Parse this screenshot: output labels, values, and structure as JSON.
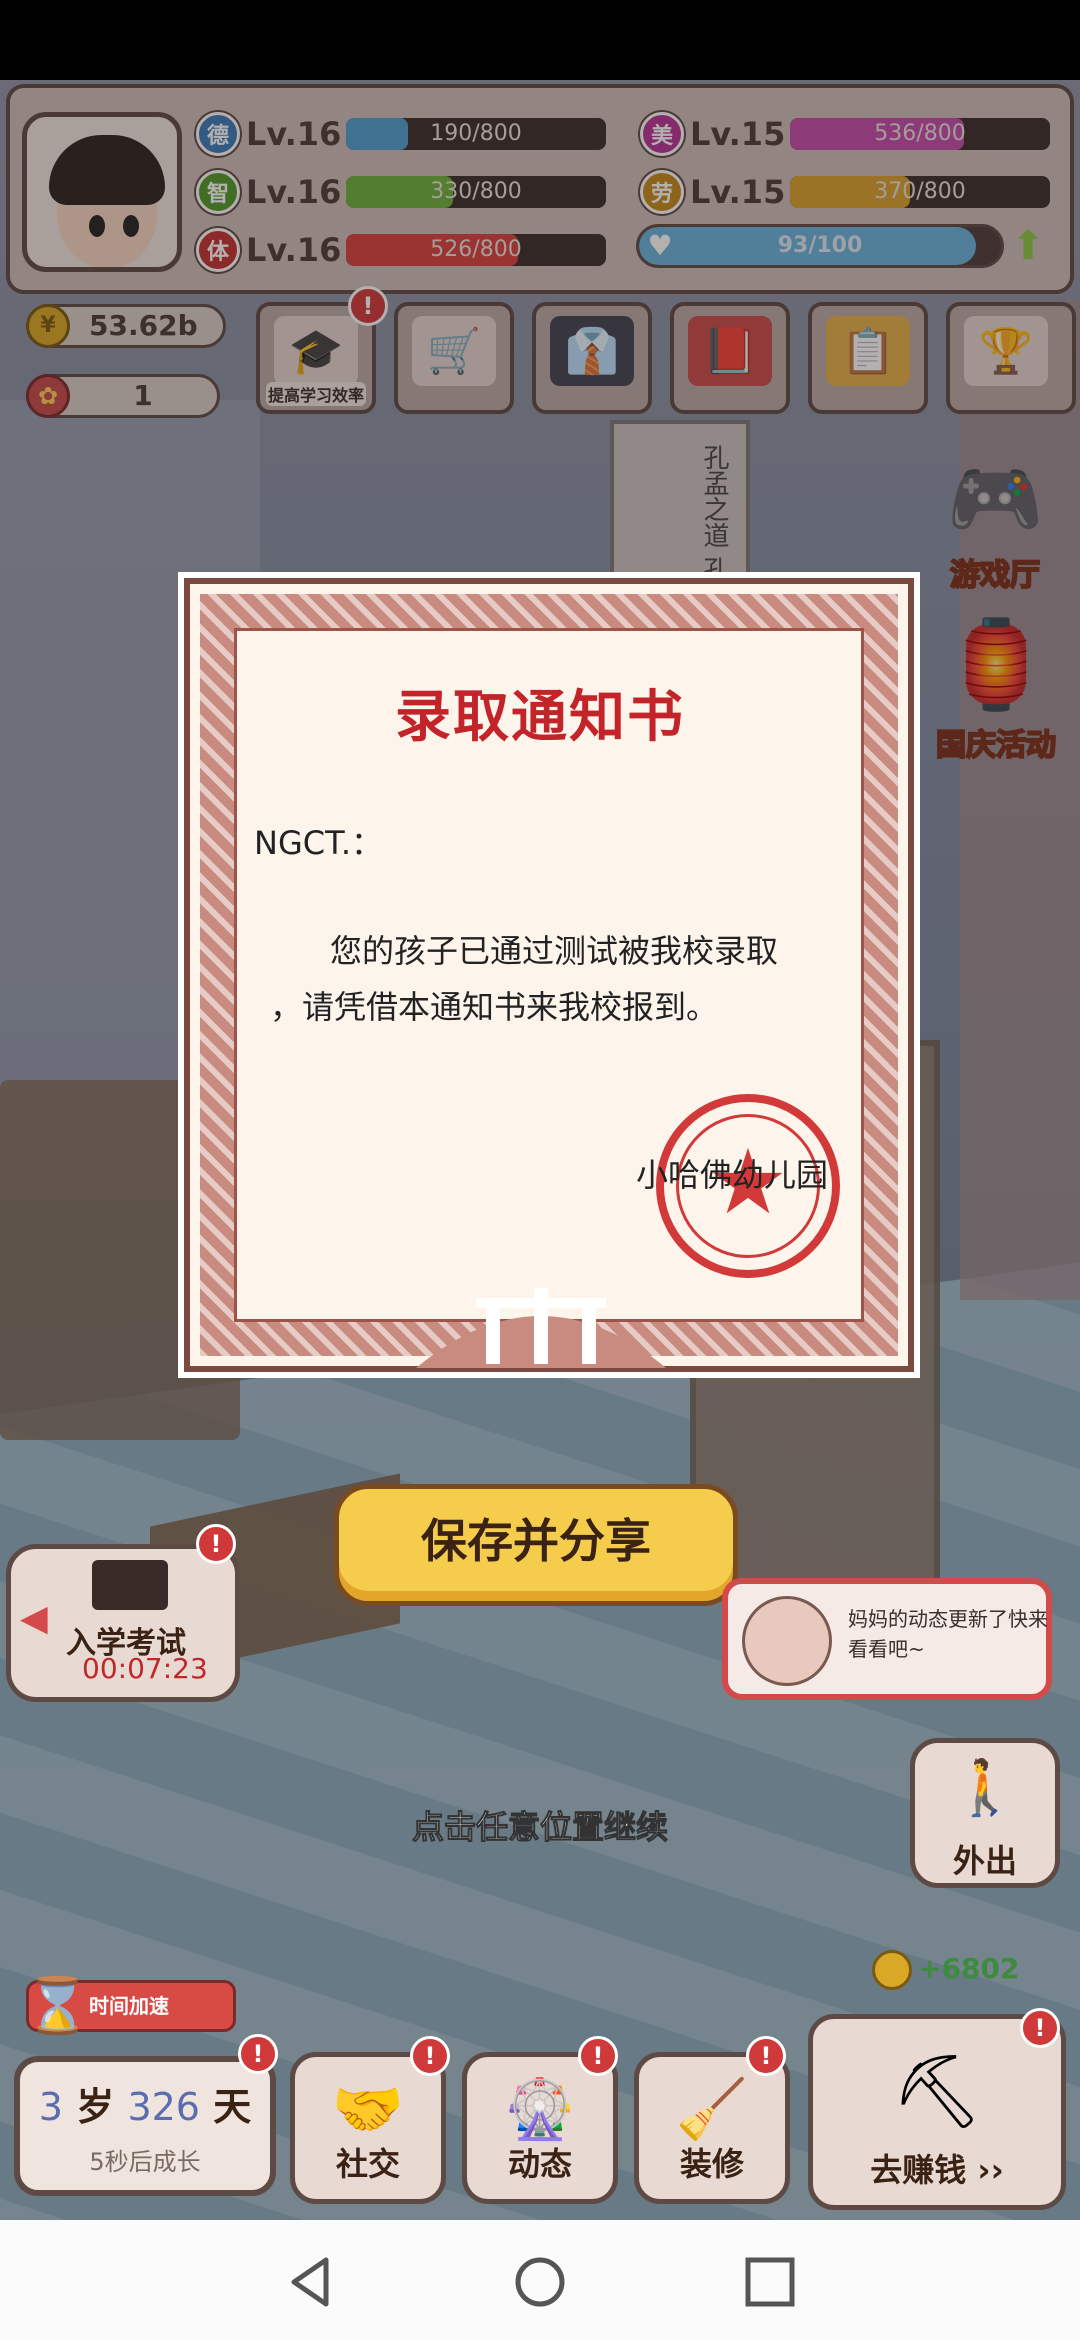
{
  "stats": [
    {
      "icon": "德",
      "level": "Lv.16",
      "bar_text": "190/800",
      "progress": 0.24,
      "color": "#4f9fcf",
      "icon_color": "#3a7bb8"
    },
    {
      "icon": "智",
      "level": "Lv.16",
      "bar_text": "330/800",
      "progress": 0.41,
      "color": "#6bb33a",
      "icon_color": "#4e9a2a"
    },
    {
      "icon": "体",
      "level": "Lv.16",
      "bar_text": "526/800",
      "progress": 0.66,
      "color": "#d8413f",
      "icon_color": "#c23030"
    },
    {
      "icon": "美",
      "level": "Lv.15",
      "bar_text": "536/800",
      "progress": 0.67,
      "color": "#c44aa9",
      "icon_color": "#b43396"
    },
    {
      "icon": "劳",
      "level": "Lv.15",
      "bar_text": "370/800",
      "progress": 0.46,
      "color": "#d7a12c",
      "icon_color": "#c28a1a"
    }
  ],
  "mood": {
    "bar_text": "93/100",
    "progress": 0.93
  },
  "currency": {
    "coins": "53.62b",
    "flowers": "1",
    "coin_icon": "coin-icon",
    "flower_icon": "flower-icon"
  },
  "toolbar": {
    "study_label": "提高学习效率",
    "items": [
      "study-efficiency",
      "shop-cart",
      "suit",
      "book",
      "clipboard",
      "ranking-podium"
    ]
  },
  "side": {
    "game_hall": "游戏厅",
    "national_day": "国庆活动"
  },
  "poster_text": "孔孟之道 孔之正宗 赶紧来学",
  "certificate": {
    "title": "录取通知书",
    "addressee": "NGCT.：",
    "body_line1": "您的孩子已通过测试被我校录取",
    "body_line2": "，请凭借本通知书来我校报到。",
    "school": "小哈佛幼儿园"
  },
  "save_button": "保存并分享",
  "exam": {
    "label": "入学考试",
    "timer": "00:07:23",
    "badge": "!"
  },
  "notification": {
    "text": "妈妈的动态更新了快来看看吧~"
  },
  "tap_continue": "点击任意位置继续",
  "go_out": "外出",
  "income": "+6802",
  "speed_up": "时间加速",
  "age": {
    "years": "3",
    "year_unit": "岁",
    "days": "326",
    "day_unit": "天",
    "sub": "5秒后成长"
  },
  "bottom_nav": [
    {
      "label": "社交",
      "icon": "handshake-icon",
      "badge": "!"
    },
    {
      "label": "动态",
      "icon": "pinwheel-icon",
      "badge": "!"
    },
    {
      "label": "装修",
      "icon": "paint-roller-icon",
      "badge": "!"
    },
    {
      "label": "去赚钱 ››",
      "icon": "pickaxe-coins-icon",
      "badge": "!"
    }
  ],
  "badge_mark": "!"
}
